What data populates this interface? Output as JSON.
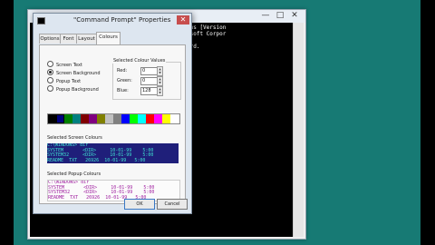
{
  "console": {
    "minimize": "—",
    "maximize": "□",
    "close": "✕",
    "text": "ows [Version\nosoft Corpor\n\nord."
  },
  "dialog": {
    "title": "\"Command Prompt\" Properties",
    "close": "✕",
    "tabs": [
      "Options",
      "Font",
      "Layout",
      "Colours"
    ],
    "active_tab": "Colours",
    "radios": [
      {
        "label": "Screen Text",
        "selected": false
      },
      {
        "label": "Screen Background",
        "selected": true
      },
      {
        "label": "Popup Text",
        "selected": false
      },
      {
        "label": "Popup Background",
        "selected": false
      }
    ],
    "selected_colour_values": {
      "group_label": "Selected Colour Values",
      "red_label": "Red:",
      "red": "0",
      "green_label": "Green:",
      "green": "0",
      "blue_label": "Blue:",
      "blue": "128"
    },
    "palette": [
      "#000000",
      "#000080",
      "#008000",
      "#008080",
      "#800000",
      "#800080",
      "#808000",
      "#c0c0c0",
      "#808080",
      "#0000ff",
      "#00ff00",
      "#00ffff",
      "#ff0000",
      "#ff00ff",
      "#ffff00",
      "#ffffff"
    ],
    "selected_palette_index": 1,
    "selected_screen_label": "Selected Screen Colours",
    "screen_preview": "C:\\WINDOWS> dir\nSYSTEM       <DIR>     10-01-99    5:00\nSYSTEM32     <DIR>     10-01-99    5:00\nREADME  TXT   26926  10-01-99   5:00",
    "selected_popup_label": "Selected Popup Colours",
    "popup_preview": "C:\\WINDOWS> dir\nSYSTEM       <DIR>     10-01-99    5:00\nSYSTEM32     <DIR>     10-01-99    5:00\nREADME  TXT   26926  10-01-99   5:00",
    "ok": "OK",
    "cancel": "Cancel"
  }
}
